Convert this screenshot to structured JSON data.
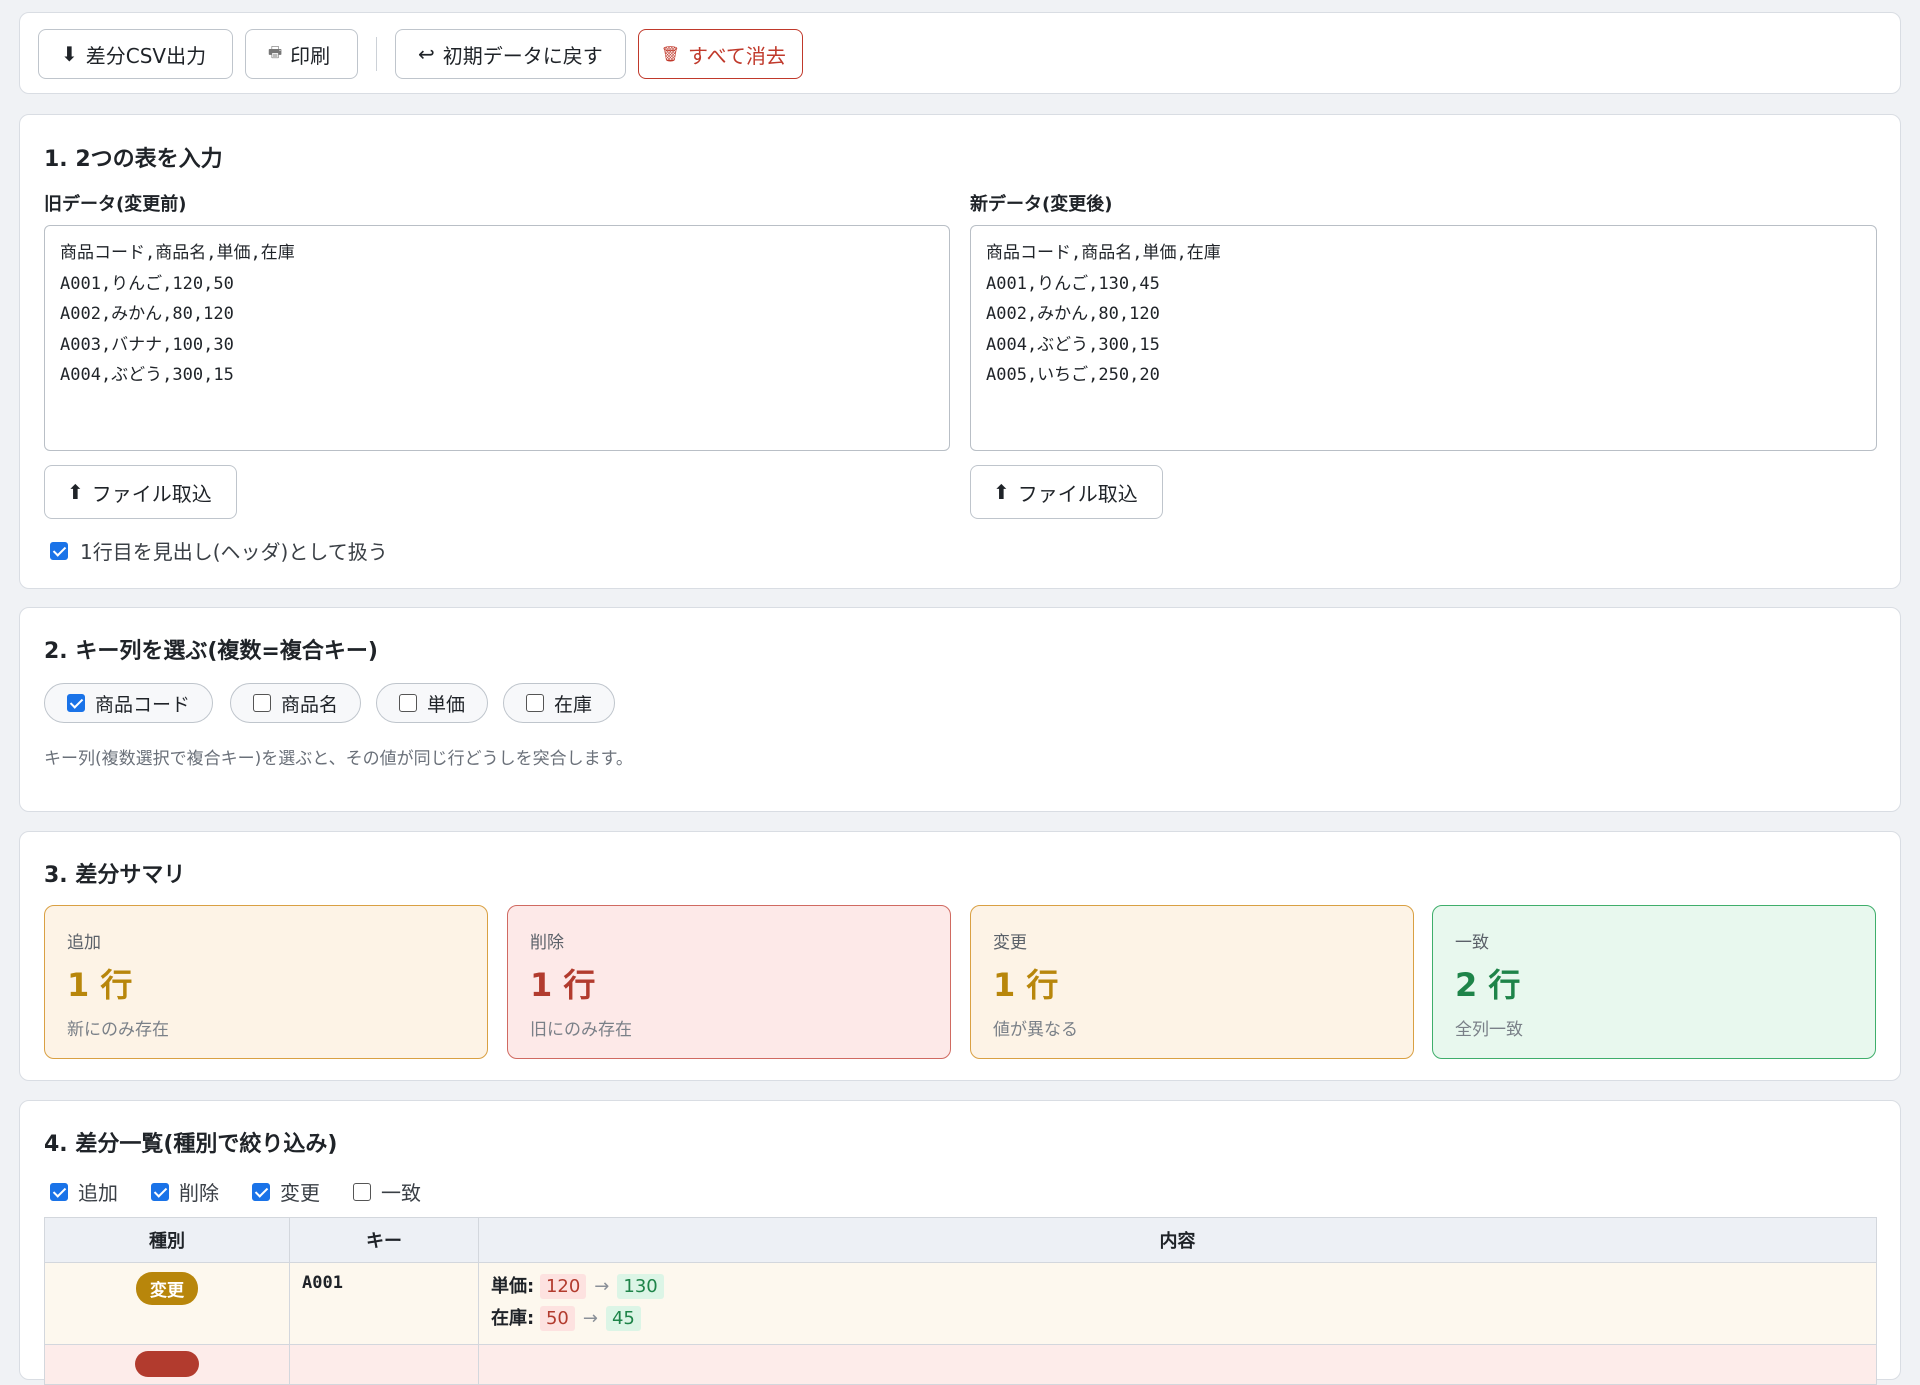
{
  "toolbar": {
    "export_csv": "差分CSV出力",
    "print": "印刷",
    "reset": "初期データに戻す",
    "clear_all": "すべて消去"
  },
  "section1": {
    "title": "1. 2つの表を入力",
    "old_label": "旧データ(変更前)",
    "new_label": "新データ(変更後)",
    "old_text": "商品コード,商品名,単価,在庫\nA001,りんご,120,50\nA002,みかん,80,120\nA003,バナナ,100,30\nA004,ぶどう,300,15",
    "new_text": "商品コード,商品名,単価,在庫\nA001,りんご,130,45\nA002,みかん,80,120\nA004,ぶどう,300,15\nA005,いちご,250,20",
    "import_label": "ファイル取込",
    "header_option": "1行目を見出し(ヘッダ)として扱う",
    "header_checked": true
  },
  "section2": {
    "title": "2. キー列を選ぶ(複数=複合キー)",
    "columns": [
      {
        "label": "商品コード",
        "checked": true
      },
      {
        "label": "商品名",
        "checked": false
      },
      {
        "label": "単価",
        "checked": false
      },
      {
        "label": "在庫",
        "checked": false
      }
    ],
    "hint": "キー列(複数選択で複合キー)を選ぶと、その値が同じ行どうしを突合します。"
  },
  "section3": {
    "title": "3. 差分サマリ",
    "cards": [
      {
        "label": "追加",
        "count": "1 行",
        "desc": "新にのみ存在",
        "color": "#b8860b",
        "bg": "#fdf3e6",
        "border": "#d9a043"
      },
      {
        "label": "削除",
        "count": "1 行",
        "desc": "旧にのみ存在",
        "color": "#b23b2e",
        "bg": "#fde9e8",
        "border": "#d06a61"
      },
      {
        "label": "変更",
        "count": "1 行",
        "desc": "値が異なる",
        "color": "#b8860b",
        "bg": "#fdf3e6",
        "border": "#d9a043"
      },
      {
        "label": "一致",
        "count": "2 行",
        "desc": "全列一致",
        "color": "#1e8449",
        "bg": "#e8f8ee",
        "border": "#3fae6b"
      }
    ]
  },
  "section4": {
    "title": "4. 差分一覧(種別で絞り込み)",
    "filters": [
      {
        "label": "追加",
        "checked": true
      },
      {
        "label": "削除",
        "checked": true
      },
      {
        "label": "変更",
        "checked": true
      },
      {
        "label": "一致",
        "checked": false
      }
    ],
    "headers": {
      "type": "種別",
      "key": "キー",
      "content": "内容"
    },
    "rows": [
      {
        "type": "変更",
        "key": "A001",
        "changes": [
          {
            "field": "単価:",
            "old": "120",
            "new": "130"
          },
          {
            "field": "在庫:",
            "old": "50",
            "new": "45"
          }
        ]
      }
    ]
  },
  "colors": {
    "accent": "#1a73e8",
    "danger": "#c0392b",
    "changed_badge": "#b8860b",
    "deleted_badge": "#b23b2e",
    "changed_row_bg": "#fdf8ee",
    "deleted_row_bg": "#fdecea"
  }
}
